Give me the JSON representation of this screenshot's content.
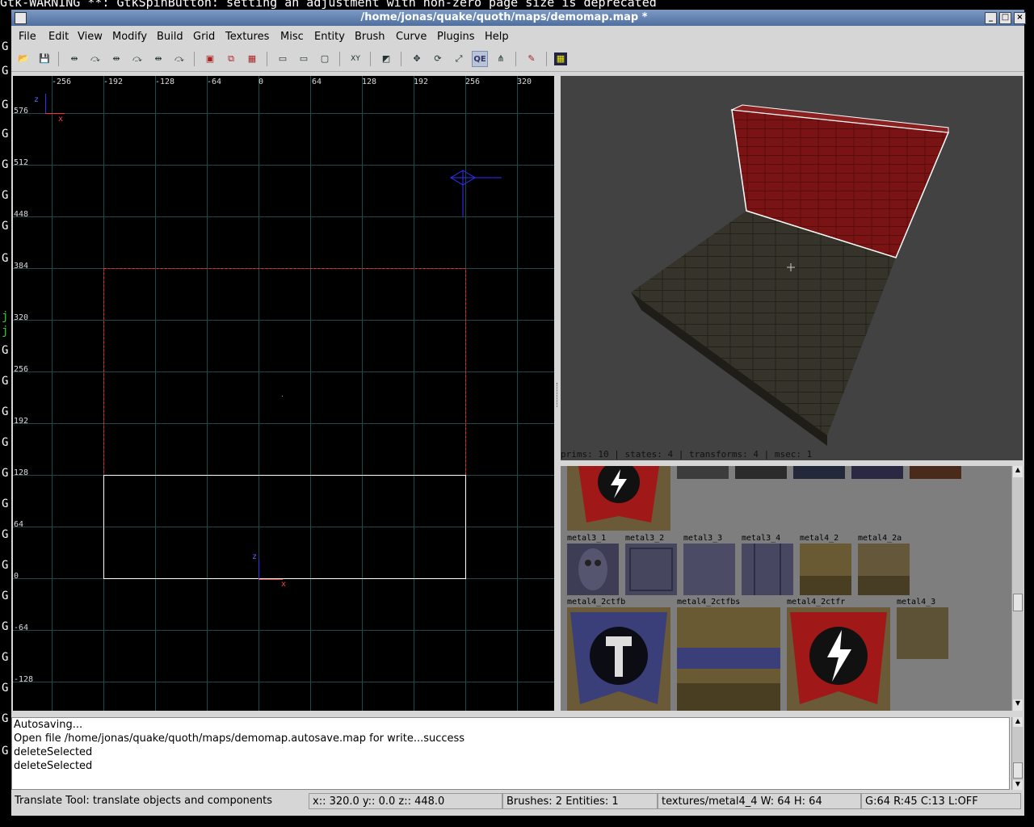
{
  "terminal": {
    "warning": "Gtk-WARNING **: GtkSpinButton: setting an adjustment with non-zero page size is deprecated",
    "left_glyphs": [
      "G",
      "G",
      "G",
      "G",
      "G",
      "G",
      "G",
      "G",
      "j",
      "j",
      "G",
      "G",
      "G",
      "G",
      "G",
      "G",
      "G",
      "G",
      "G",
      "G",
      "G",
      "G",
      "G",
      "G"
    ]
  },
  "window": {
    "title": "/home/jonas/quake/quoth/maps/demomap.map *"
  },
  "menubar": [
    "File",
    "Edit",
    "View",
    "Modify",
    "Build",
    "Grid",
    "Textures",
    "Misc",
    "Entity",
    "Brush",
    "Curve",
    "Plugins",
    "Help"
  ],
  "toolbar": {
    "icons": [
      "open-icon",
      "save-icon",
      "flip-x-icon",
      "rotate-x-icon",
      "flip-y-icon",
      "rotate-y-icon",
      "flip-z-icon",
      "rotate-z-icon",
      "select-complete-tall-icon",
      "select-touching-icon",
      "select-partial-tall-icon",
      "csg-subtract-icon",
      "csg-merge-icon",
      "csg-hollow-icon",
      "xy-view-icon",
      "camera-texture-icon",
      "translate-icon",
      "rotate-icon",
      "scale-icon",
      "qe-tool-icon",
      "vertex-edit-icon",
      "entity-brush-icon",
      "patch-icon"
    ],
    "qe_label": "QE"
  },
  "xy_view": {
    "top_labels": [
      "-256",
      "-192",
      "-128",
      "-64",
      "0",
      "64",
      "128",
      "192",
      "256",
      "320"
    ],
    "left_labels": [
      "576",
      "512",
      "448",
      "384",
      "320",
      "256",
      "192",
      "128",
      "64",
      "0",
      "-64",
      "-128"
    ],
    "axis_top": {
      "vertical": "z",
      "horizontal": "x"
    },
    "origin_axis": {
      "vertical": "z",
      "horizontal": "x"
    }
  },
  "camera_view": {
    "status": "prims: 10 | states: 4 | transforms: 4 | msec: 1"
  },
  "texture_browser": {
    "row2": [
      "metal3_1",
      "metal3_2",
      "metal3_3",
      "metal3_4",
      "metal4_2",
      "metal4_2a"
    ],
    "row3": [
      "metal4_2ctfb",
      "metal4_2ctfbs",
      "metal4_2ctfr",
      "metal4_3"
    ]
  },
  "console": {
    "lines": [
      "Autosaving...",
      "Open file /home/jonas/quake/quoth/maps/demomap.autosave.map for write...success",
      "deleteSelected",
      "deleteSelected"
    ]
  },
  "statusbar": {
    "tool": "Translate Tool: translate objects and components",
    "coords": "x::  320.0  y::    0.0  z::  448.0",
    "counts": "Brushes: 2 Entities: 1",
    "texture": "textures/metal4_4 W: 64 H: 64",
    "grid": "G:64  R:45  C:13  L:OFF"
  },
  "colors": {
    "grid_line": "#1f4a4a",
    "selection": "#ff2020",
    "brick": "#7a1414",
    "floor": "#35332a",
    "title_bg": "#5a7aa9",
    "panel_bg": "#d6d6d6"
  }
}
